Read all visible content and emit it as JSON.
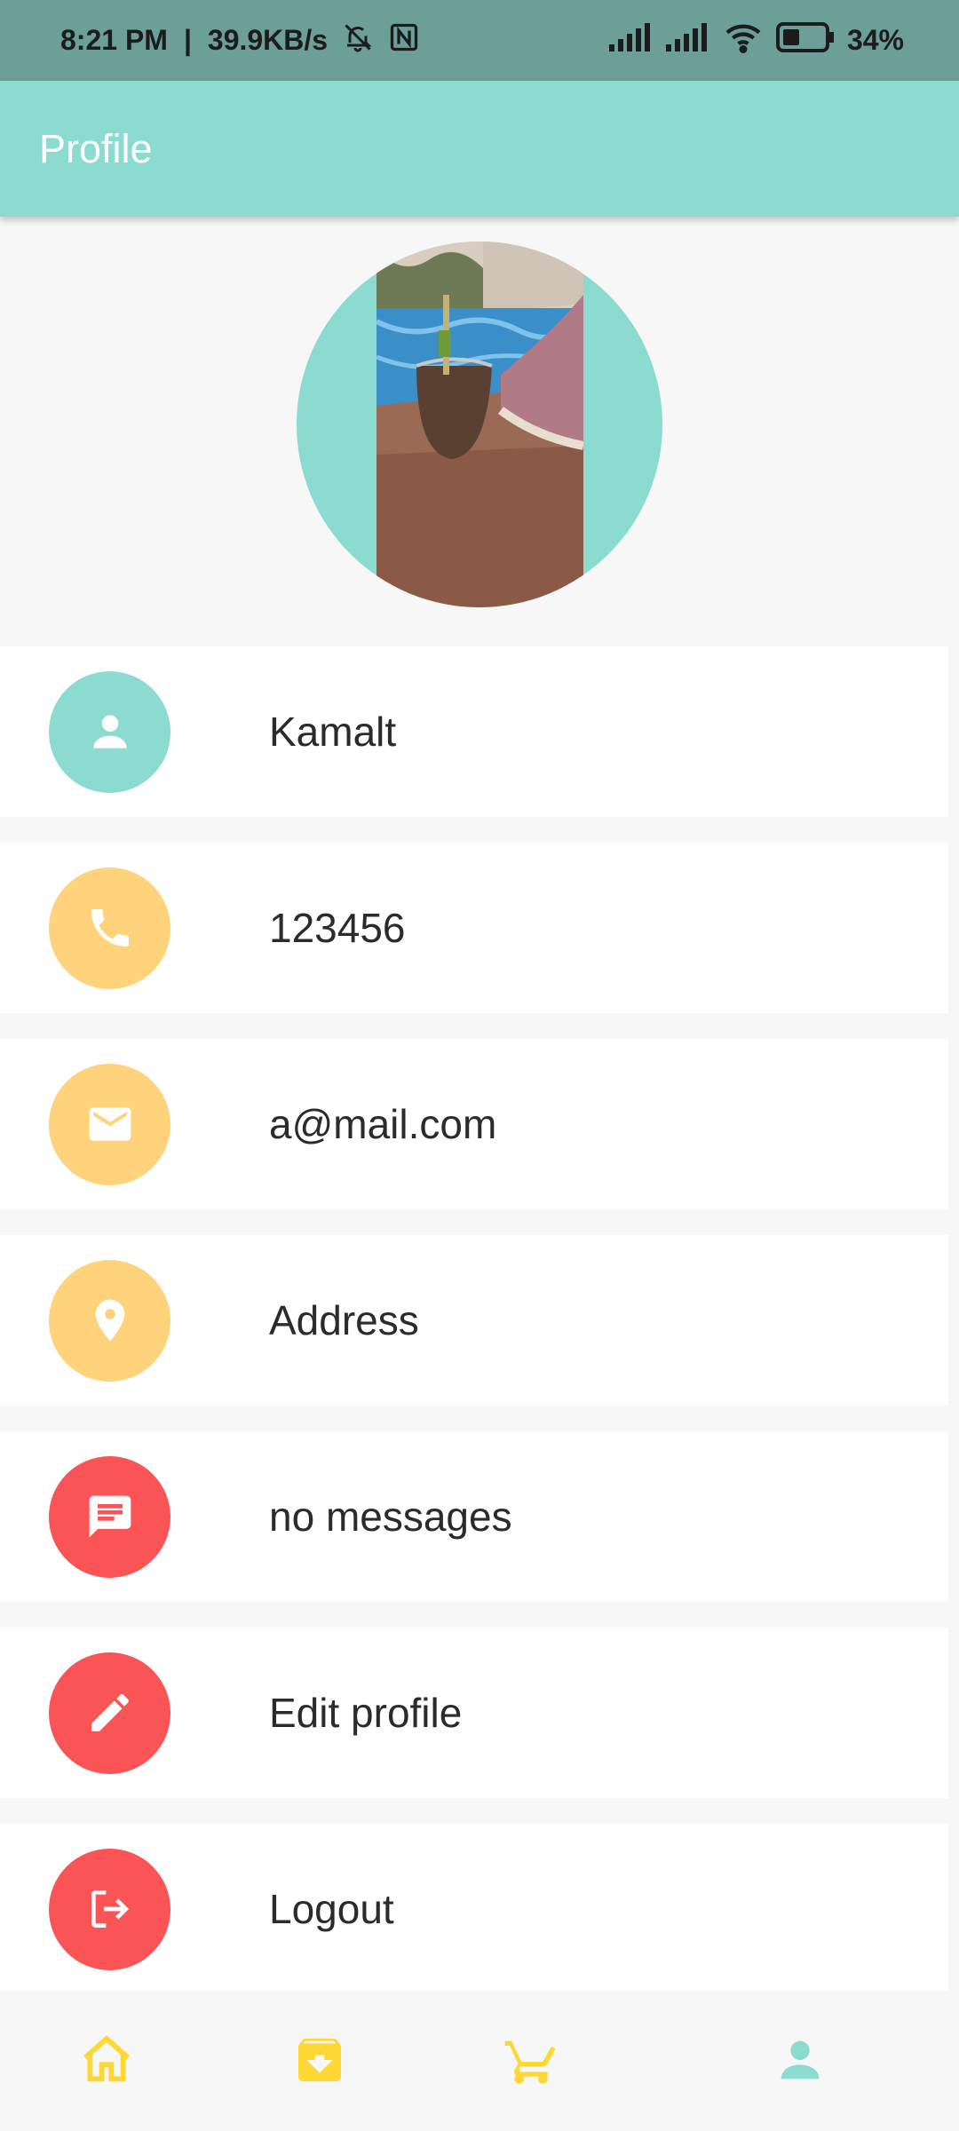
{
  "status_bar": {
    "time": "8:21 PM",
    "separator": "|",
    "net_speed": "39.9KB/s",
    "battery": "34%"
  },
  "app_bar": {
    "title": "Profile"
  },
  "profile_items": [
    {
      "label": "Kamalt",
      "icon": "person-icon"
    },
    {
      "label": "123456",
      "icon": "phone-icon"
    },
    {
      "label": "a@mail.com",
      "icon": "mail-icon"
    },
    {
      "label": "Address",
      "icon": "location-icon"
    },
    {
      "label": "no messages",
      "icon": "message-icon"
    },
    {
      "label": "Edit profile",
      "icon": "pencil-icon"
    },
    {
      "label": "Logout",
      "icon": "logout-icon"
    }
  ],
  "bottom_nav": [
    {
      "icon": "home-icon",
      "active": false
    },
    {
      "icon": "archive-icon",
      "active": false
    },
    {
      "icon": "cart-icon",
      "active": false
    },
    {
      "icon": "person-icon",
      "active": true
    }
  ],
  "colors": {
    "primary": "#8bdbd0",
    "accent_yellow": "#ffd37c",
    "accent_red": "#fa5457",
    "nav_yellow": "#fdd835"
  }
}
